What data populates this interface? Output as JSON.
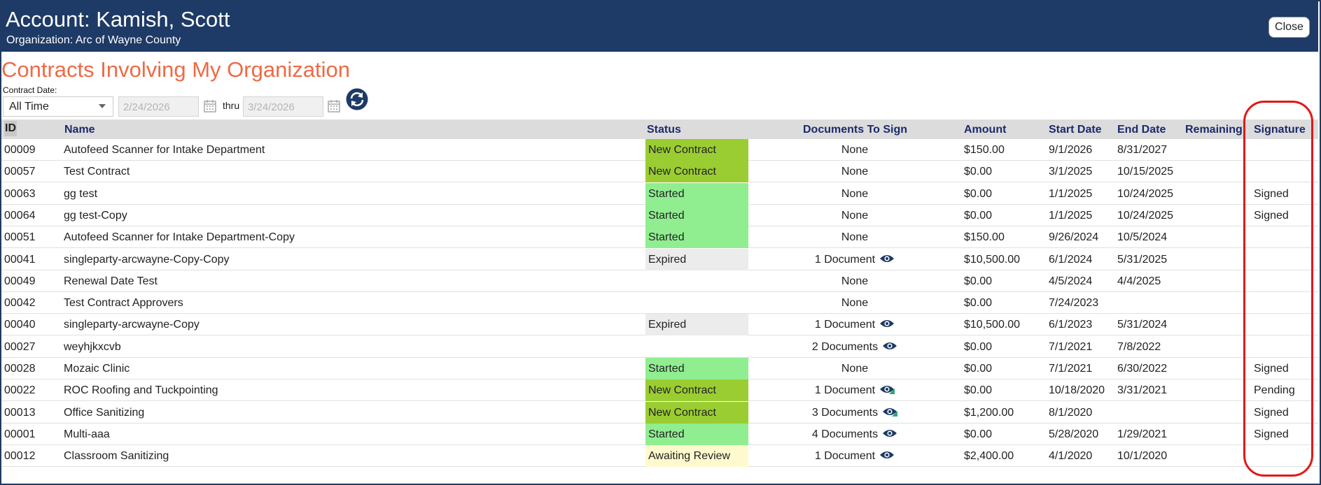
{
  "header": {
    "account_title": "Account: Kamish, Scott",
    "organization": "Organization: Arc of Wayne County",
    "close_label": "Close"
  },
  "page_title": "Contracts Involving My Organization",
  "filters": {
    "contract_date_label": "Contract Date:",
    "range_selected": "All Time",
    "from_placeholder": "2/24/2026",
    "thru_label": "thru",
    "to_placeholder": "3/24/2026"
  },
  "table": {
    "columns": {
      "id": "ID",
      "name": "Name",
      "status": "Status",
      "docs": "Documents To Sign",
      "amount": "Amount",
      "start": "Start Date",
      "end": "End Date",
      "remaining": "Remaining",
      "signature": "Signature"
    },
    "rows": [
      {
        "id": "00009",
        "name": "Autofeed Scanner for Intake Department",
        "status": "New Contract",
        "docs": "None",
        "has_eye": false,
        "eye_partial": false,
        "amount": "$150.00",
        "start": "9/1/2026",
        "end": "8/31/2027",
        "signature": ""
      },
      {
        "id": "00057",
        "name": "Test Contract",
        "status": "New Contract",
        "docs": "None",
        "has_eye": false,
        "eye_partial": false,
        "amount": "$0.00",
        "start": "3/1/2025",
        "end": "10/15/2025",
        "signature": ""
      },
      {
        "id": "00063",
        "name": "gg test",
        "status": "Started",
        "docs": "None",
        "has_eye": false,
        "eye_partial": false,
        "amount": "$0.00",
        "start": "1/1/2025",
        "end": "10/24/2025",
        "signature": "Signed"
      },
      {
        "id": "00064",
        "name": "gg test-Copy",
        "status": "Started",
        "docs": "None",
        "has_eye": false,
        "eye_partial": false,
        "amount": "$0.00",
        "start": "1/1/2025",
        "end": "10/24/2025",
        "signature": "Signed"
      },
      {
        "id": "00051",
        "name": "Autofeed Scanner for Intake Department-Copy",
        "status": "Started",
        "docs": "None",
        "has_eye": false,
        "eye_partial": false,
        "amount": "$150.00",
        "start": "9/26/2024",
        "end": "10/5/2024",
        "signature": ""
      },
      {
        "id": "00041",
        "name": "singleparty-arcwayne-Copy-Copy",
        "status": "Expired",
        "docs": "1 Document",
        "has_eye": true,
        "eye_partial": false,
        "amount": "$10,500.00",
        "start": "6/1/2024",
        "end": "5/31/2025",
        "signature": ""
      },
      {
        "id": "00049",
        "name": "Renewal Date Test",
        "status": "",
        "docs": "None",
        "has_eye": false,
        "eye_partial": false,
        "amount": "$0.00",
        "start": "4/5/2024",
        "end": "4/4/2025",
        "signature": ""
      },
      {
        "id": "00042",
        "name": "Test Contract Approvers",
        "status": "",
        "docs": "None",
        "has_eye": false,
        "eye_partial": false,
        "amount": "$0.00",
        "start": "7/24/2023",
        "end": "",
        "signature": ""
      },
      {
        "id": "00040",
        "name": "singleparty-arcwayne-Copy",
        "status": "Expired",
        "docs": "1 Document",
        "has_eye": true,
        "eye_partial": false,
        "amount": "$10,500.00",
        "start": "6/1/2023",
        "end": "5/31/2024",
        "signature": ""
      },
      {
        "id": "00027",
        "name": "weyhjkxcvb",
        "status": "",
        "docs": "2 Documents",
        "has_eye": true,
        "eye_partial": false,
        "amount": "$0.00",
        "start": "7/1/2021",
        "end": "7/8/2022",
        "signature": ""
      },
      {
        "id": "00028",
        "name": "Mozaic Clinic",
        "status": "Started",
        "docs": "None",
        "has_eye": false,
        "eye_partial": false,
        "amount": "$0.00",
        "start": "7/1/2021",
        "end": "6/30/2022",
        "signature": "Signed"
      },
      {
        "id": "00022",
        "name": "ROC Roofing and Tuckpointing",
        "status": "New Contract",
        "docs": "1 Document",
        "has_eye": true,
        "eye_partial": true,
        "amount": "$0.00",
        "start": "10/18/2020",
        "end": "3/31/2021",
        "signature": "Pending"
      },
      {
        "id": "00013",
        "name": "Office Sanitizing",
        "status": "New Contract",
        "docs": "3 Documents",
        "has_eye": true,
        "eye_partial": true,
        "amount": "$1,200.00",
        "start": "8/1/2020",
        "end": "",
        "signature": "Signed"
      },
      {
        "id": "00001",
        "name": "Multi-aaa",
        "status": "Started",
        "docs": "4 Documents",
        "has_eye": true,
        "eye_partial": false,
        "amount": "$0.00",
        "start": "5/28/2020",
        "end": "1/29/2021",
        "signature": "Signed"
      },
      {
        "id": "00012",
        "name": "Classroom Sanitizing",
        "status": "Awaiting Review",
        "docs": "1 Document",
        "has_eye": true,
        "eye_partial": false,
        "amount": "$2,400.00",
        "start": "4/1/2020",
        "end": "10/1/2020",
        "signature": ""
      }
    ]
  },
  "status_colors": {
    "New Contract": "#9acd32",
    "Started": "#90ee90",
    "Expired": "#ececec",
    "Awaiting Review": "#fffacd"
  },
  "colors": {
    "header_bg": "#1e3a66",
    "title": "#ee6a45",
    "column_header_text": "#1c2a6b",
    "eye_icon": "#1e3a66",
    "eye_icon_partial_accent": "#2aa876",
    "annotation_highlight": "#e01818"
  }
}
